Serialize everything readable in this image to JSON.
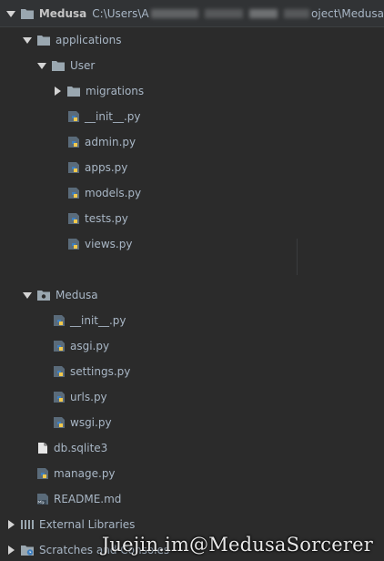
{
  "project": {
    "name": "Medusa",
    "path_prefix": "C:\\Users\\A",
    "path_suffix": "oject\\Medusa"
  },
  "tree": {
    "applications": "applications",
    "user": "User",
    "migrations": "migrations",
    "user_files": [
      "__init__.py",
      "admin.py",
      "apps.py",
      "models.py",
      "tests.py",
      "views.py"
    ],
    "medusa_pkg": "Medusa",
    "medusa_files": [
      "__init__.py",
      "asgi.py",
      "settings.py",
      "urls.py",
      "wsgi.py"
    ],
    "db": "db.sqlite3",
    "manage": "manage.py",
    "readme": "README.md",
    "external_libraries": "External Libraries",
    "scratches": "Scratches and Consoles"
  },
  "watermark": "Juejin.im@MedusaSorcerer",
  "colors": {
    "background": "#2b2b2b",
    "text": "#a9b7c6",
    "folder": "#9aa7b0",
    "python_blue": "#3f7fbf",
    "python_yellow": "#f2c94c"
  }
}
